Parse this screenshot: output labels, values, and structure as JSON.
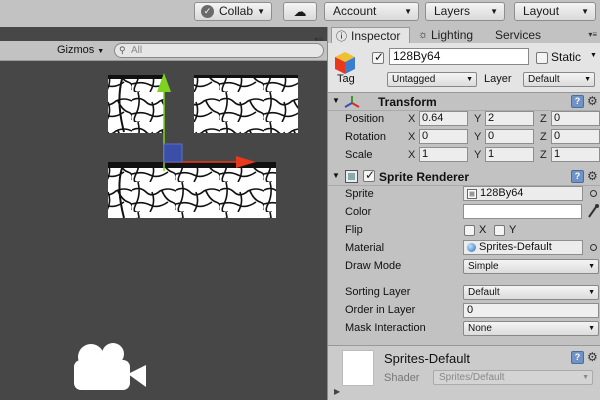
{
  "toolbar": {
    "collab_label": "Collab",
    "cloud_icon": "cloud-icon",
    "account_label": "Account",
    "layers_label": "Layers",
    "layout_label": "Layout"
  },
  "scene": {
    "gizmos_label": "Gizmos",
    "search_placeholder": "All",
    "camera_icon": "camera-icon"
  },
  "inspector": {
    "tabs": {
      "inspector": "Inspector",
      "lighting": "Lighting",
      "services": "Services"
    },
    "gameobject": {
      "active": true,
      "name": "128By64",
      "static_label": "Static",
      "static": false,
      "tag_label": "Tag",
      "tag_value": "Untagged",
      "layer_label": "Layer",
      "layer_value": "Default"
    },
    "transform": {
      "title": "Transform",
      "position_label": "Position",
      "rotation_label": "Rotation",
      "scale_label": "Scale",
      "axes": {
        "x": "X",
        "y": "Y",
        "z": "Z"
      },
      "position": {
        "x": "0.64",
        "y": "2",
        "z": "0"
      },
      "rotation": {
        "x": "0",
        "y": "0",
        "z": "0"
      },
      "scale": {
        "x": "1",
        "y": "1",
        "z": "1"
      }
    },
    "sprite_renderer": {
      "title": "Sprite Renderer",
      "enabled": true,
      "sprite_label": "Sprite",
      "sprite_value": "128By64",
      "color_label": "Color",
      "color_value": "#ffffff",
      "flip_label": "Flip",
      "flip_x": "X",
      "flip_y": "Y",
      "material_label": "Material",
      "material_value": "Sprites-Default",
      "draw_mode_label": "Draw Mode",
      "draw_mode_value": "Simple",
      "sorting_layer_label": "Sorting Layer",
      "sorting_layer_value": "Default",
      "order_label": "Order in Layer",
      "order_value": "0",
      "mask_label": "Mask Interaction",
      "mask_value": "None"
    },
    "material_preview": {
      "name": "Sprites-Default",
      "shader_label": "Shader",
      "shader_value": "Sprites/Default"
    }
  },
  "colors": {
    "scene_bg": "#474747",
    "panel_bg": "#c2c2c2",
    "axis_y": "#7ed321",
    "axis_x": "#e8391c",
    "axis_z": "#3b4fa8"
  }
}
